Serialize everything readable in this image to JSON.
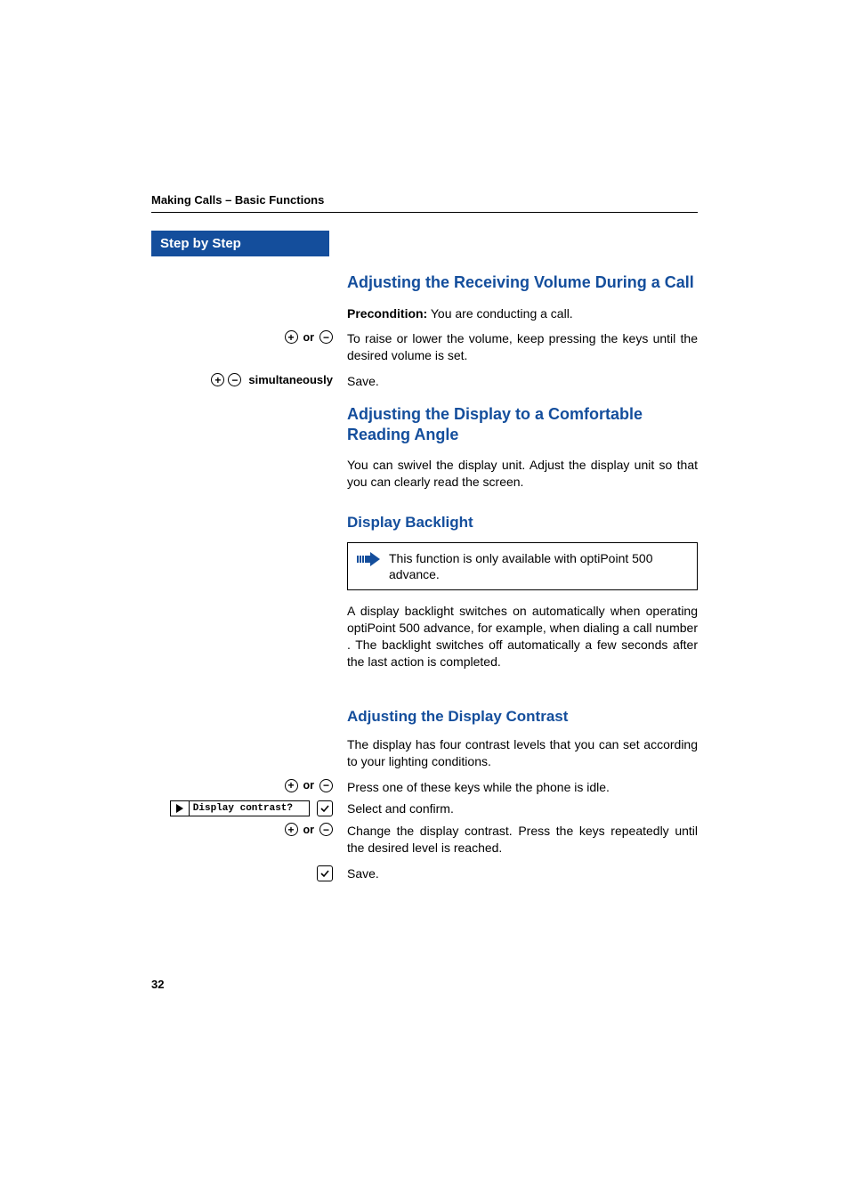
{
  "running_head": "Making Calls – Basic Functions",
  "step_header": "Step by Step",
  "sections": {
    "s1": {
      "title": "Adjusting the Receiving Volume During a Call",
      "precondition_label": "Precondition:",
      "precondition_text": " You are conducting a call.",
      "step1_left_or": "or",
      "step1_text": "To raise or lower the volume, keep pressing the keys until the desired volume is set.",
      "step2_left_label": "simultaneously",
      "step2_text": "Save."
    },
    "s2": {
      "title": "Adjusting the Display to a Comfortable Reading Angle",
      "body": "You can swivel the display unit. Adjust the display unit so that you can clearly read the screen."
    },
    "s3": {
      "title": "Display Backlight",
      "note": "This function is only available with optiPoint 500 advance.",
      "body": "A display backlight switches on automatically when operating optiPoint 500 advance, for example, when dialing a call number . The backlight switches off automatically a few seconds after the last action is completed."
    },
    "s4": {
      "title": "Adjusting the Display Contrast",
      "intro": "The display has four contrast levels that you can set according to your lighting conditions.",
      "step1_or": "or",
      "step1_text": "Press one of these keys while the phone is idle.",
      "step2_menu": "Display contrast?",
      "step2_text": "Select and confirm.",
      "step3_or": "or",
      "step3_text": "Change the display contrast. Press the keys repeatedly until the desired level is reached.",
      "step4_text": "Save."
    }
  },
  "page_number": "32"
}
